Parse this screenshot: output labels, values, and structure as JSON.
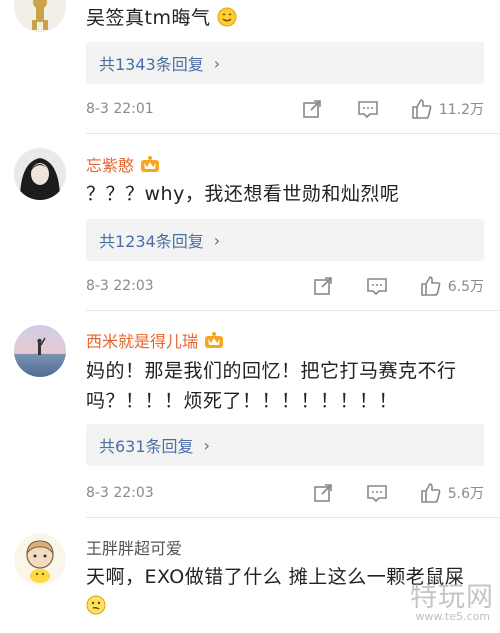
{
  "comments": [
    {
      "text": "吴签真tm晦气",
      "emoji": "smile-emoji",
      "replies_label": "共1343条回复",
      "date": "8-3 22:01",
      "likes": "11.2万"
    },
    {
      "username": "忘紫憨",
      "text": "？？？why，我还想看世勋和灿烈呢",
      "replies_label": "共1234条回复",
      "date": "8-3 22:03",
      "likes": "6.5万"
    },
    {
      "username": "西米就是得儿瑞",
      "text": "妈的！那是我们的回忆！把它打马赛克不行吗？！！！烦死了！！！！！！！！",
      "replies_label": "共631条回复",
      "date": "8-3 22:03",
      "likes": "5.6万"
    },
    {
      "username": "王胖胖超可爱",
      "text": "天啊，EXO做错了什么 摊上这么一颗老鼠屎",
      "emoji": "smirk-emoji"
    }
  ],
  "watermark": {
    "main": "特玩网",
    "sub": "www.te5.com"
  },
  "colors": {
    "username": "#e8642e",
    "reply_link": "#4a6fa5",
    "meta": "#8a8a8a",
    "reply_bg": "#f3f3f3"
  }
}
